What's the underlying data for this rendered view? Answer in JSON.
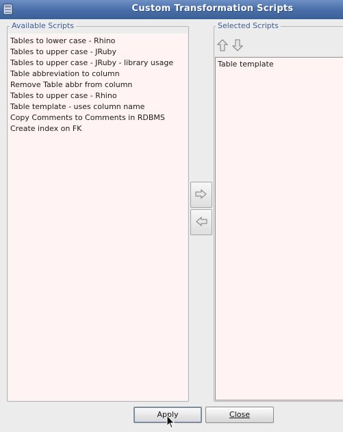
{
  "window": {
    "title": "Custom Transformation Scripts"
  },
  "available": {
    "legend": "Available Scripts",
    "items": [
      "Tables to lower case - Rhino",
      "Tables to upper case - JRuby",
      "Tables to upper case - JRuby - library usage",
      "Table abbreviation to column",
      "Remove Table abbr from column",
      "Tables to upper case - Rhino",
      "Table template - uses column name",
      "Copy Comments to Comments in RDBMS",
      "Create index on FK"
    ]
  },
  "selected": {
    "legend": "Selected Scripts",
    "items": [
      "Table template"
    ]
  },
  "icons": {
    "move_up": "arrow-up-icon",
    "move_down": "arrow-down-icon",
    "add": "arrow-right-icon",
    "remove": "arrow-left-icon",
    "app": "app-icon",
    "cursor": "mouse-cursor-icon"
  },
  "buttons": {
    "apply": "Apply",
    "close": "Close"
  },
  "colors": {
    "titlebar": "#4a6fa8",
    "legend": "#3a5c99",
    "list_bg": "#fff3f3"
  }
}
